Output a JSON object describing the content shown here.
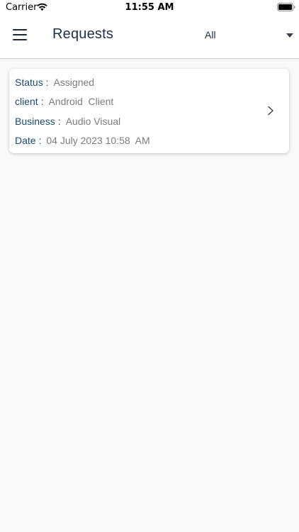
{
  "status_bar": {
    "carrier": "Carrier",
    "time": "11:55 AM"
  },
  "header": {
    "title": "Requests",
    "filter_value": "All"
  },
  "requests": [
    {
      "status_label": "Status :",
      "status_value": "Assigned",
      "client_label": "client :",
      "client_value": "Android  Client",
      "business_label": "Business :",
      "business_value": "Audio Visual",
      "date_label": "Date :",
      "date_value": "04 July 2023 10:58  AM"
    }
  ],
  "icons": {
    "menu": "hamburger-menu-icon",
    "dropdown": "caret-down-icon",
    "chevron": "chevron-right-icon",
    "wifi": "wifi-icon",
    "battery": "battery-icon"
  },
  "colors": {
    "label": "#1d4a6b",
    "value": "#7c7c7c",
    "title": "#1f3045",
    "background": "#f9f9f9"
  }
}
